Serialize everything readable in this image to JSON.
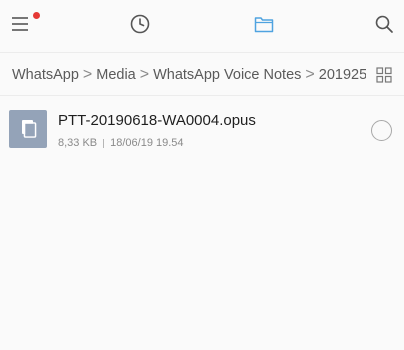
{
  "toolbar": {
    "icons": [
      "menu-icon",
      "recent-clock-icon",
      "folder-icon",
      "search-icon"
    ],
    "notification_color": "#e53935",
    "active_tab": "files"
  },
  "breadcrumb": {
    "items": [
      "WhatsApp",
      "Media",
      "WhatsApp Voice Notes",
      "201925"
    ],
    "separator": ">"
  },
  "files": [
    {
      "name": "PTT-20190618-WA0004.opus",
      "size": "8,33 KB",
      "date": "18/06/19 19.54",
      "icon": "document-icon"
    }
  ],
  "colors": {
    "accent": "#4fa3e0",
    "thumb": "#94a3b8",
    "text_primary": "#1f1f1f",
    "text_secondary": "#8a8a8a"
  }
}
